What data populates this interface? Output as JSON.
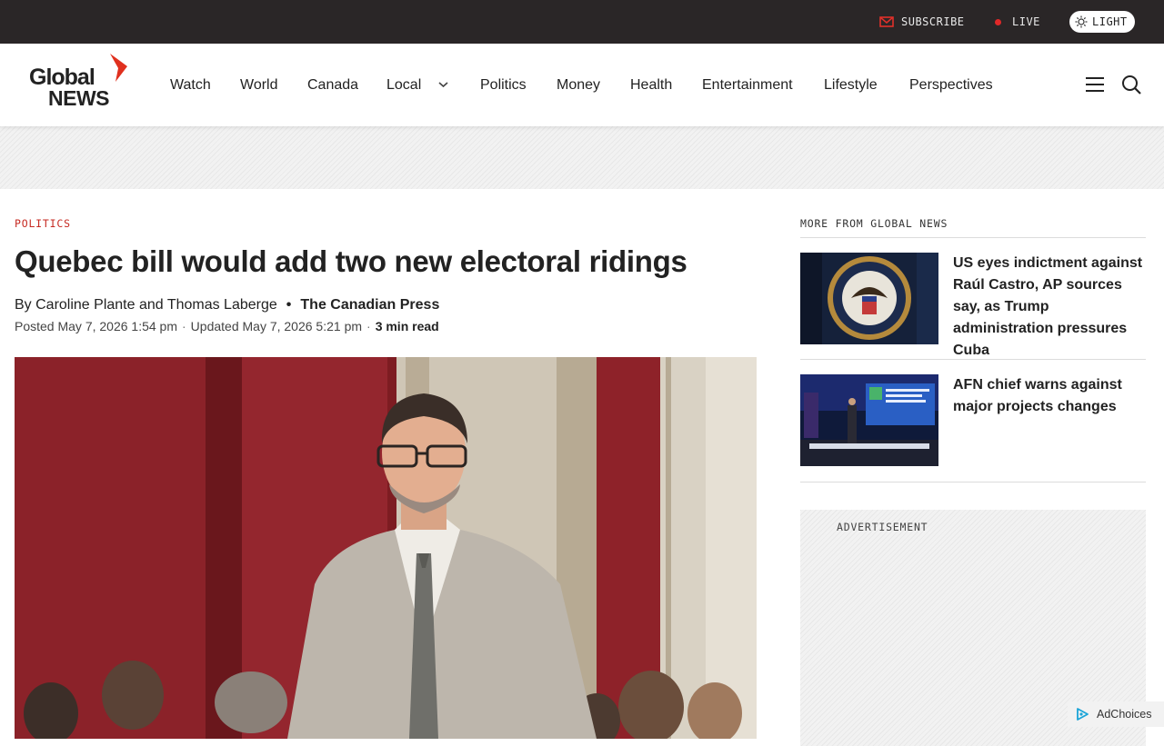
{
  "utility": {
    "subscribe_label": "SUBSCRIBE",
    "live_label": "LIVE",
    "theme_label": "LIGHT"
  },
  "brand": {
    "logo_top": "Global",
    "logo_bottom": "NEWS",
    "accent": "#e0301e"
  },
  "nav": {
    "items": [
      "Watch",
      "World",
      "Canada",
      "Local",
      "Politics",
      "Money",
      "Health",
      "Entertainment",
      "Lifestyle",
      "Perspectives"
    ],
    "menu_icon": "hamburger-icon",
    "search_icon": "search-icon"
  },
  "article": {
    "category": "POLITICS",
    "headline": "Quebec bill would add two new electoral ridings",
    "authors": "By Caroline Plante and Thomas Laberge",
    "separator": "•",
    "source": "The Canadian Press",
    "posted": "Posted May 7, 2026 1:54 pm",
    "updated": "Updated May 7, 2026 5:21 pm",
    "read_time": "3 min read",
    "dot": "·"
  },
  "sidebar": {
    "heading": "MORE FROM GLOBAL NEWS",
    "stories": [
      {
        "title": "US eyes indictment against Raúl Castro, AP sources say, as Trump administration pressures Cuba"
      },
      {
        "title": "AFN chief warns against major projects changes"
      }
    ]
  },
  "ad": {
    "label": "ADVERTISEMENT",
    "adchoices": "AdChoices"
  }
}
